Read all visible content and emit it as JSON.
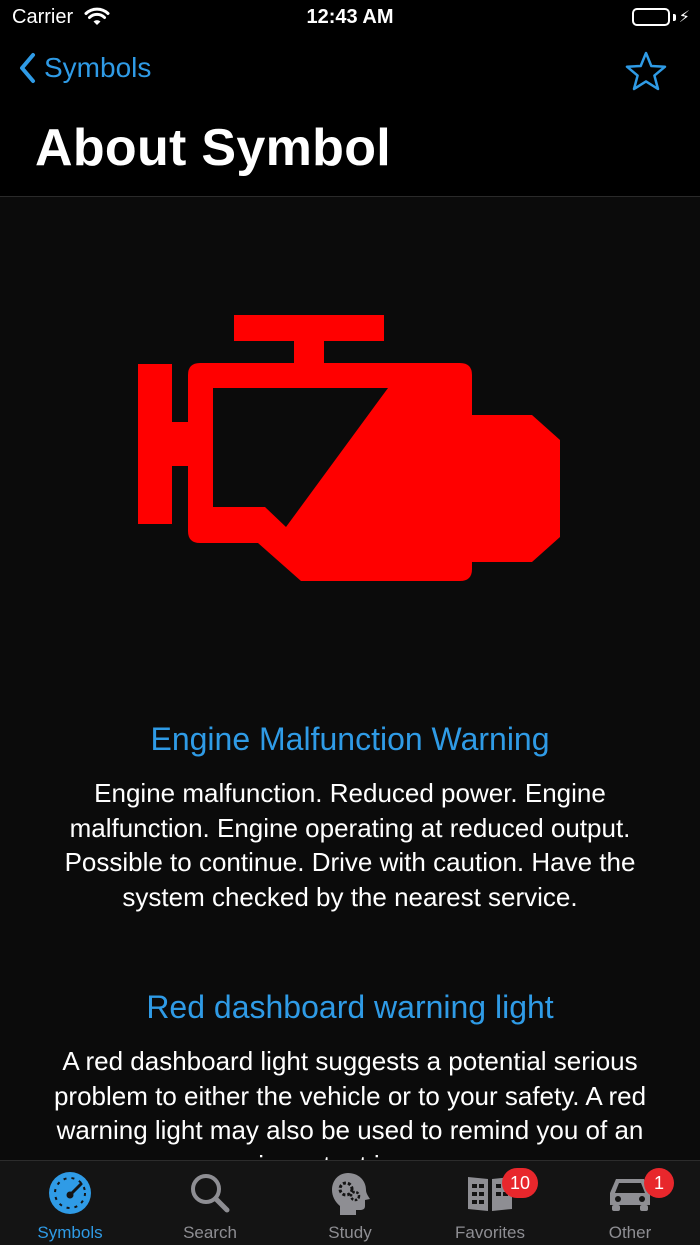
{
  "status_bar": {
    "carrier": "Carrier",
    "time": "12:43 AM"
  },
  "nav": {
    "back_label": "Symbols",
    "title": "About Symbol"
  },
  "symbol": {
    "icon": "engine-malfunction-icon",
    "color": "#ff0000"
  },
  "sections": [
    {
      "heading": "Engine Malfunction Warning",
      "body": "Engine malfunction. Reduced power. Engine malfunction. Engine operating at reduced output. Possible to continue. Drive with caution. Have the system checked by the nearest service."
    },
    {
      "heading": "Red dashboard warning light",
      "body": "A red dashboard light suggests a potential serious problem to either the vehicle or to your safety. A red warning light may also be used to remind you of an important issue."
    }
  ],
  "tabs": [
    {
      "label": "Symbols",
      "icon": "speedometer-icon",
      "active": true
    },
    {
      "label": "Search",
      "icon": "search-icon"
    },
    {
      "label": "Study",
      "icon": "head-gears-icon"
    },
    {
      "label": "Favorites",
      "icon": "book-icon",
      "badge": "10"
    },
    {
      "label": "Other",
      "icon": "car-icon",
      "badge": "1"
    }
  ],
  "colors": {
    "accent": "#2f9be6",
    "warning_red": "#ff0000",
    "badge_red": "#e8272c",
    "battery_green": "#39d353"
  }
}
